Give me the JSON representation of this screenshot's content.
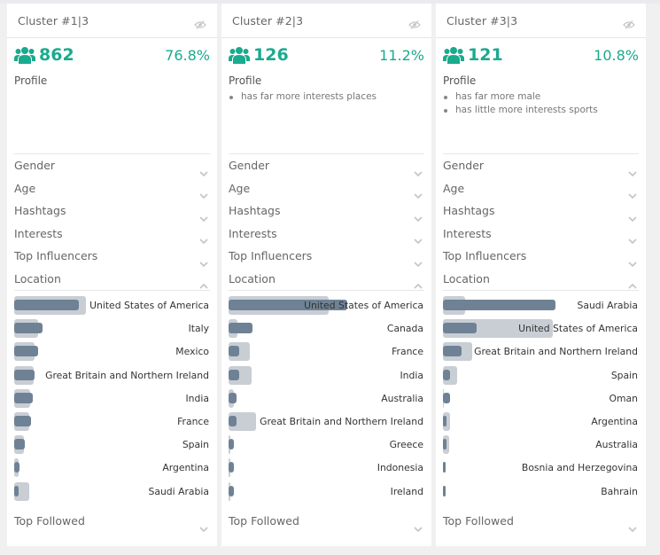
{
  "colors": {
    "accent": "#1aaa8e",
    "bar_cluster": "#6f8295",
    "bar_overall": "#c8ced4"
  },
  "icons": {
    "users": "users-icon",
    "hidden": "eye-slash-icon",
    "collapsed": "chevron-down-icon",
    "expanded": "chevron-up-icon"
  },
  "clusters": [
    {
      "title": "Cluster #1|3",
      "count": "862",
      "percent": "76.8%",
      "profile_title": "Profile",
      "profile_items": [],
      "sections": [
        "Gender",
        "Age",
        "Hashtags",
        "Interests",
        "Top Influencers",
        "Location"
      ],
      "location": [
        {
          "name": "United States of America",
          "overall": 0.6,
          "cluster": 0.54
        },
        {
          "name": "Italy",
          "overall": 0.2,
          "cluster": 0.24
        },
        {
          "name": "Mexico",
          "overall": 0.17,
          "cluster": 0.2
        },
        {
          "name": "Great Britain and Northern Ireland",
          "overall": 0.16,
          "cluster": 0.17
        },
        {
          "name": "India",
          "overall": 0.13,
          "cluster": 0.155
        },
        {
          "name": "France",
          "overall": 0.125,
          "cluster": 0.14
        },
        {
          "name": "Spain",
          "overall": 0.08,
          "cluster": 0.09
        },
        {
          "name": "Argentina",
          "overall": 0.037,
          "cluster": 0.045
        },
        {
          "name": "Saudi Arabia",
          "overall": 0.125,
          "cluster": 0.037
        }
      ],
      "top_followed": "Top Followed"
    },
    {
      "title": "Cluster #2|3",
      "count": "126",
      "percent": "11.2%",
      "profile_title": "Profile",
      "profile_items": [
        "has far more interests places"
      ],
      "sections": [
        "Gender",
        "Age",
        "Hashtags",
        "Interests",
        "Top Influencers",
        "Location"
      ],
      "location": [
        {
          "name": "United States of America",
          "overall": 0.84,
          "cluster": 0.99
        },
        {
          "name": "Canada",
          "overall": 0.074,
          "cluster": 0.2
        },
        {
          "name": "France",
          "overall": 0.177,
          "cluster": 0.09
        },
        {
          "name": "India",
          "overall": 0.19,
          "cluster": 0.09
        },
        {
          "name": "Australia",
          "overall": 0.044,
          "cluster": 0.066
        },
        {
          "name": "Great Britain and Northern Ireland",
          "overall": 0.23,
          "cluster": 0.066
        },
        {
          "name": "Greece",
          "overall": 0.015,
          "cluster": 0.044
        },
        {
          "name": "Indonesia",
          "overall": 0.015,
          "cluster": 0.044
        },
        {
          "name": "Ireland",
          "overall": 0.015,
          "cluster": 0.044
        }
      ],
      "top_followed": "Top Followed"
    },
    {
      "title": "Cluster #3|3",
      "count": "121",
      "percent": "10.8%",
      "profile_title": "Profile",
      "profile_items": [
        "has far more male",
        "has little more interests sports"
      ],
      "sections": [
        "Gender",
        "Age",
        "Hashtags",
        "Interests",
        "Top Influencers",
        "Location"
      ],
      "location": [
        {
          "name": "Saudi Arabia",
          "overall": 0.185,
          "cluster": 0.94
        },
        {
          "name": "United States of America",
          "overall": 0.92,
          "cluster": 0.28
        },
        {
          "name": "Great Britain and Northern Ireland",
          "overall": 0.245,
          "cluster": 0.155
        },
        {
          "name": "Spain",
          "overall": 0.118,
          "cluster": 0.06
        },
        {
          "name": "Oman",
          "overall": 0.007,
          "cluster": 0.06
        },
        {
          "name": "Argentina",
          "overall": 0.06,
          "cluster": 0.03
        },
        {
          "name": "Australia",
          "overall": 0.052,
          "cluster": 0.03
        },
        {
          "name": "Bosnia and Herzegovina",
          "overall": 0.0,
          "cluster": 0.022
        },
        {
          "name": "Bahrain",
          "overall": 0.0,
          "cluster": 0.022
        }
      ],
      "top_followed": "Top Followed"
    }
  ]
}
